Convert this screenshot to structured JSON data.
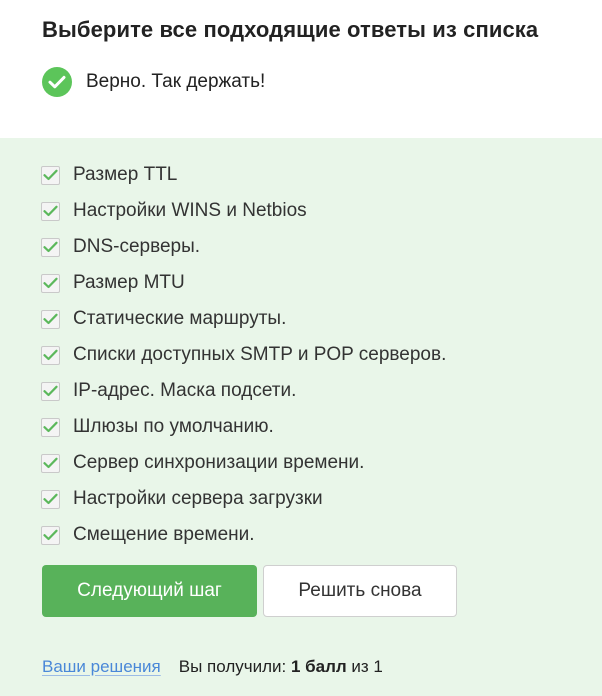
{
  "header": {
    "title": "Выберите все подходящие ответы из списка",
    "status_text": "Верно. Так держать!",
    "status_icon": "check-circle-icon",
    "status_color": "#5cc55a"
  },
  "options": [
    {
      "label": "Размер TTL",
      "checked": true
    },
    {
      "label": "Настройки WINS и Netbios",
      "checked": true
    },
    {
      "label": "DNS-серверы.",
      "checked": true
    },
    {
      "label": "Размер MTU",
      "checked": true
    },
    {
      "label": "Статические маршруты.",
      "checked": true
    },
    {
      "label": "Списки доступных SMTP и POP серверов.",
      "checked": true
    },
    {
      "label": "IP-адрес. Маска подсети.",
      "checked": true
    },
    {
      "label": "Шлюзы по умолчанию.",
      "checked": true
    },
    {
      "label": "Сервер синхронизации времени.",
      "checked": true
    },
    {
      "label": "Настройки сервера загрузки",
      "checked": true
    },
    {
      "label": "Смещение времени.",
      "checked": true
    }
  ],
  "actions": {
    "next_label": "Следующий шаг",
    "retry_label": "Решить снова"
  },
  "footer": {
    "solutions_link": "Ваши решения",
    "score_prefix": "Вы получили: ",
    "score_value": "1 балл",
    "score_suffix": " из 1"
  },
  "colors": {
    "panel_bg": "#e9f6e9",
    "primary_button": "#58b25a",
    "check_mark": "#5cb85c",
    "link": "#4a88d8"
  }
}
